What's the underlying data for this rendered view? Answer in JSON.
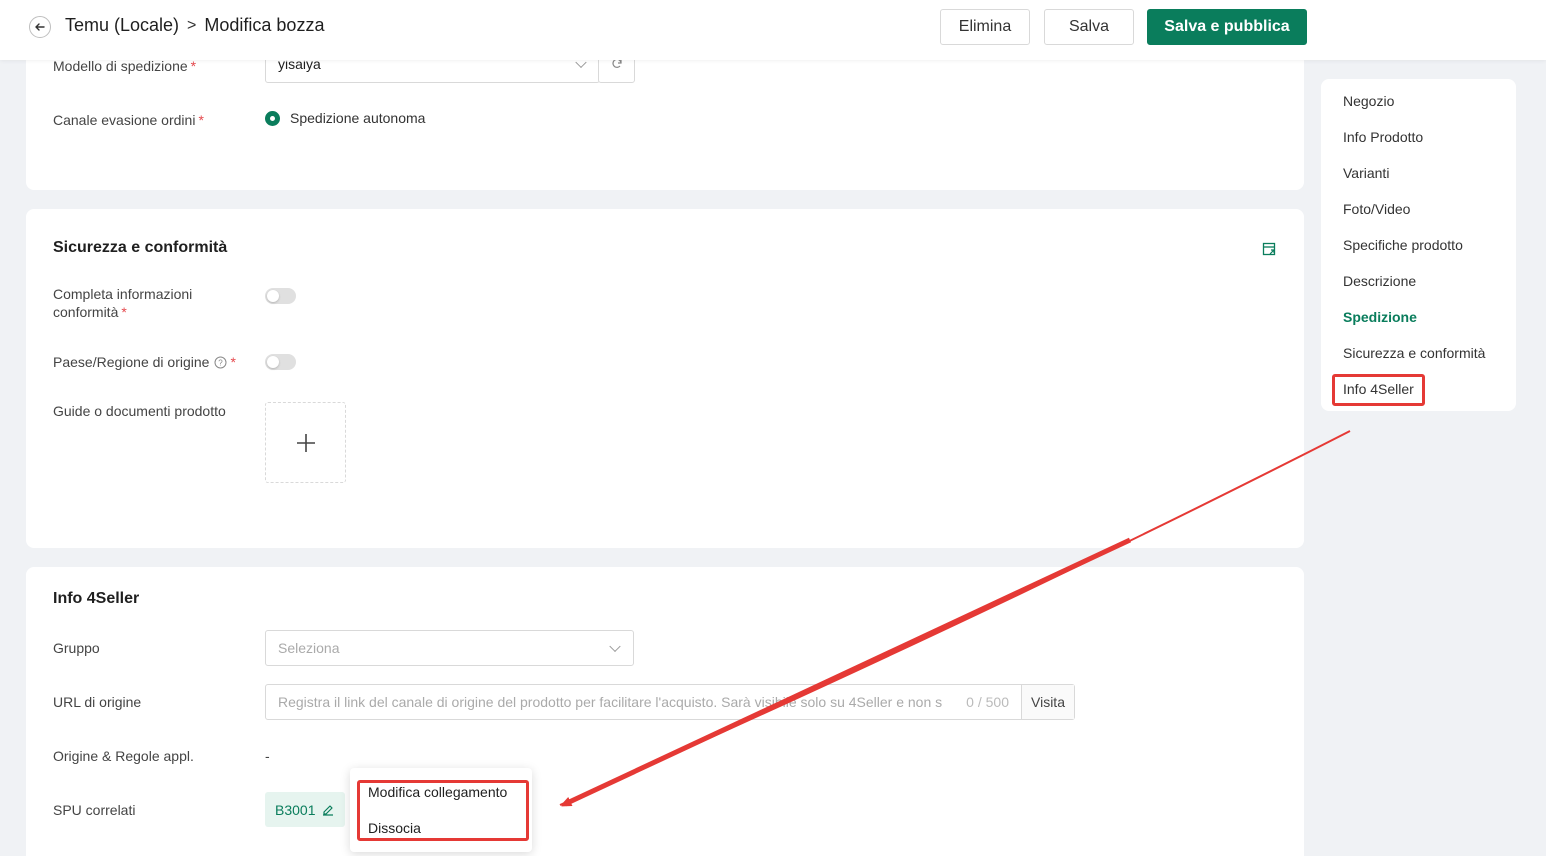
{
  "header": {
    "breadcrumb_parent": "Temu (Locale)",
    "breadcrumb_separator": ">",
    "breadcrumb_current": "Modifica bozza",
    "delete_label": "Elimina",
    "save_label": "Salva",
    "publish_label": "Salva e pubblica"
  },
  "shipping": {
    "template_label": "Modello di spedizione",
    "template_value": "yisaiya",
    "channel_label": "Canale evasione ordini",
    "channel_option": "Spedizione autonoma"
  },
  "safety": {
    "title": "Sicurezza e conformità",
    "compliance_label_line1": "Completa informazioni",
    "compliance_label_line2": "conformità",
    "origin_label": "Paese/Regione di origine",
    "docs_label": "Guide o documenti prodotto"
  },
  "info4seller": {
    "title": "Info 4Seller",
    "group_label": "Gruppo",
    "group_placeholder": "Seleziona",
    "url_label": "URL di origine",
    "url_placeholder": "Registra il link del canale di origine del prodotto per facilitare l'acquisto. Sarà visibile solo su 4Seller e non s",
    "url_count": "0 / 500",
    "url_visit": "Visita",
    "rules_label": "Origine & Regole appl.",
    "rules_value": "-",
    "spu_label": "SPU correlati",
    "spu_value": "B3001"
  },
  "popover": {
    "edit_link": "Modifica collegamento",
    "unlink": "Dissocia"
  },
  "nav": {
    "items": [
      "Negozio",
      "Info Prodotto",
      "Varianti",
      "Foto/Video",
      "Specifiche prodotto",
      "Descrizione",
      "Spedizione",
      "Sicurezza e conformità",
      "Info 4Seller"
    ],
    "active": "Spedizione"
  },
  "colors": {
    "accent": "#0a7d5c",
    "annotation": "#e53935",
    "required": "#e5484d"
  }
}
